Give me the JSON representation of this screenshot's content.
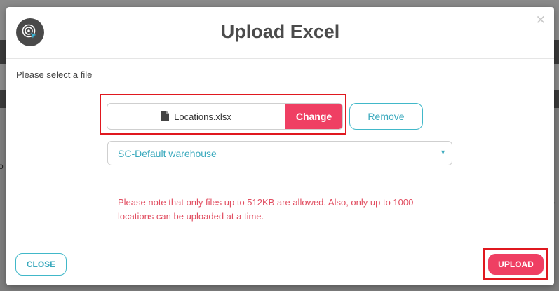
{
  "dialog": {
    "title": "Upload Excel",
    "close_icon": "close-icon",
    "logo_icon": "target-cursor-icon"
  },
  "form": {
    "prompt": "Please select a file",
    "file": {
      "icon": "file-icon",
      "name": "Locations.xlsx",
      "change_label": "Change",
      "remove_label": "Remove"
    },
    "warehouse_select": {
      "selected": "SC-Default warehouse"
    },
    "note": "Please note that only files up to 512KB are allowed. Also, only up to 1000 locations can be uploaded at a time."
  },
  "footer": {
    "close_label": "CLOSE",
    "upload_label": "UPLOAD"
  },
  "background": {
    "fragment_left": "o",
    "fragment_right": "r"
  },
  "colors": {
    "accent_pink": "#ef3f63",
    "accent_teal": "#3aa9bd",
    "note_red": "#e14d60",
    "highlight_red": "#e0181f"
  }
}
